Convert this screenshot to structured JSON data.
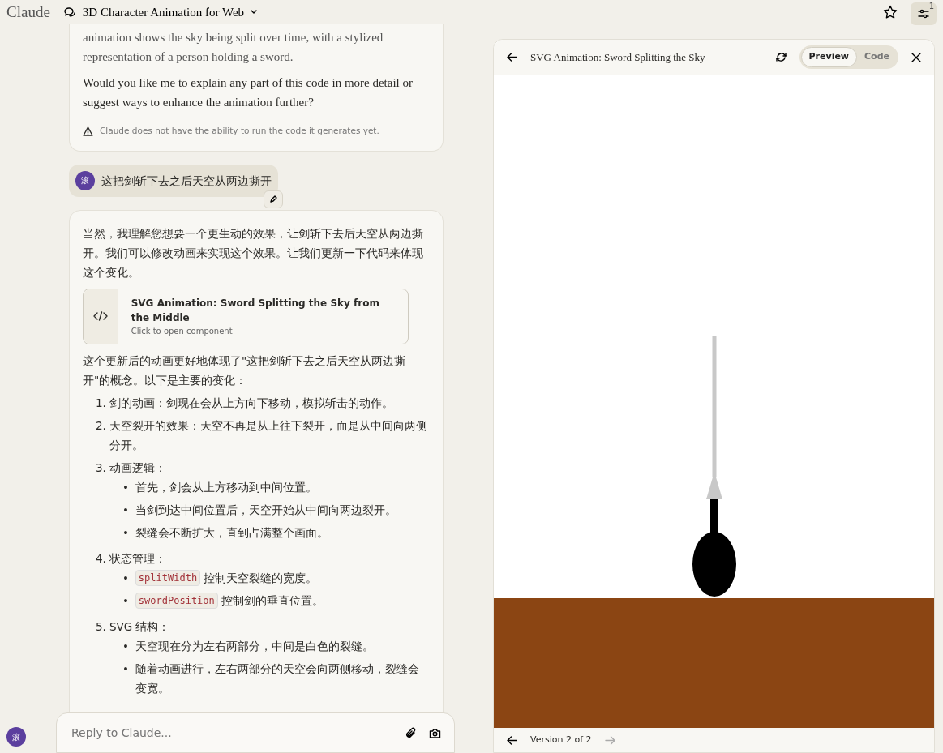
{
  "header": {
    "brand": "Claude",
    "title": "3D Character Animation for Web",
    "badge": "1"
  },
  "previous_reply": {
    "paragraphs": [
      "animation shows the sky being split over time, with a stylized representation of a person holding a sword.",
      "Would you like me to explain any part of this code in more detail or suggest ways to enhance the animation further?"
    ],
    "notice": "Claude does not have the ability to run the code it generates yet."
  },
  "user_message": {
    "avatar": "滚",
    "text": "这把剑斩下去之后天空从两边撕开"
  },
  "reply": {
    "intro": "当然，我理解您想要一个更生动的效果，让剑斩下去后天空从两边撕开。我们可以修改动画来实现这个效果。让我们更新一下代码来体现这个变化。",
    "artifact": {
      "title": "SVG Animation: Sword Splitting the Sky from the Middle",
      "subtitle": "Click to open component"
    },
    "summary": "这个更新后的动画更好地体现了\"这把剑斩下去之后天空从两边撕开\"的概念。以下是主要的变化：",
    "items": [
      {
        "number": "1.",
        "text": "剑的动画：剑现在会从上方向下移动，模拟斩击的动作。"
      },
      {
        "number": "2.",
        "text": "天空裂开的效果：天空不再是从上往下裂开，而是从中间向两侧分开。"
      },
      {
        "number": "3.",
        "text": "动画逻辑：",
        "children": [
          {
            "marker": "•",
            "text": "首先，剑会从上方移动到中间位置。"
          },
          {
            "marker": "•",
            "text": "当剑到达中间位置后，天空开始从中间向两边裂开。"
          },
          {
            "marker": "•",
            "text": "裂缝会不断扩大，直到占满整个画面。"
          }
        ]
      },
      {
        "number": "4.",
        "text": "状态管理：",
        "children": [
          {
            "marker": "•",
            "code": "splitWidth",
            "text": "控制天空裂缝的宽度。"
          },
          {
            "marker": "•",
            "code": "swordPosition",
            "text": "控制剑的垂直位置。"
          }
        ]
      },
      {
        "number": "5.",
        "text": "SVG 结构：",
        "children": [
          {
            "marker": "•",
            "text": "天空现在分为左右两部分，中间是白色的裂缝。"
          },
          {
            "marker": "•",
            "text": "随着动画进行，左右两部分的天空会向两侧移动，裂缝会变宽。"
          }
        ]
      }
    ]
  },
  "composer": {
    "placeholder": "Reply to Claude...",
    "avatar": "滚"
  },
  "artifact_panel": {
    "title": "SVG Animation: Sword Splitting the Sky",
    "tabs": [
      {
        "label": "Preview",
        "selected": true
      },
      {
        "label": "Code",
        "selected": false
      }
    ],
    "version": "Version 2 of 2"
  }
}
